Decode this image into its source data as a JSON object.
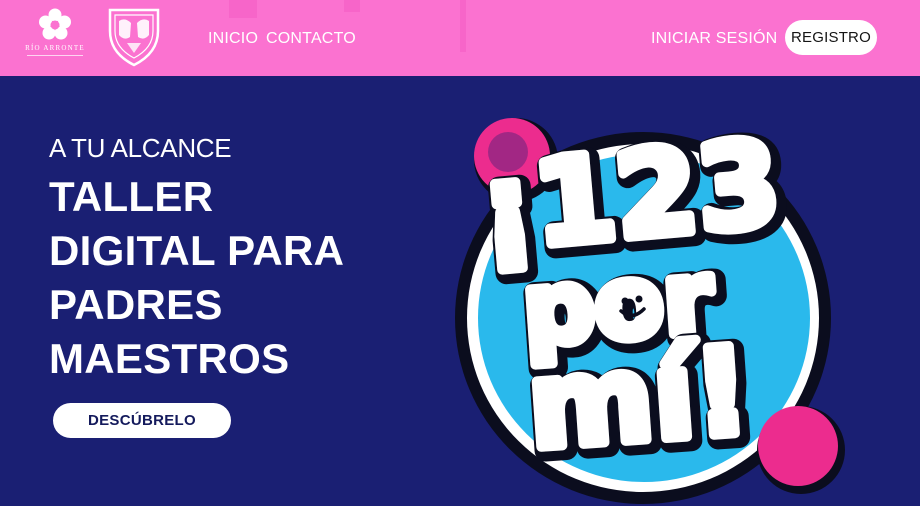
{
  "header": {
    "logo_text": "RÍO ARRONTE",
    "nav": {
      "inicio": "INICIO",
      "contacto": "CONTACTO",
      "login": "INICIAR SESIÓN",
      "registro": "REGISTRO"
    }
  },
  "hero": {
    "eyebrow": "A TU ALCANCE",
    "title_lines": [
      "TALLER",
      "DIGITAL PARA",
      "PADRES",
      "MAESTROS"
    ],
    "cta": "DESCÚBRELO"
  },
  "artwork": {
    "name": "¡123 por mí!",
    "line1": "¡123",
    "line2": "por",
    "line3": "mí!"
  },
  "colors": {
    "header_bg": "#fb72d0",
    "hero_bg": "#1a1f73",
    "circle_blue": "#2ab9ec",
    "accent_pink": "#ec2c8e",
    "white": "#ffffff"
  }
}
